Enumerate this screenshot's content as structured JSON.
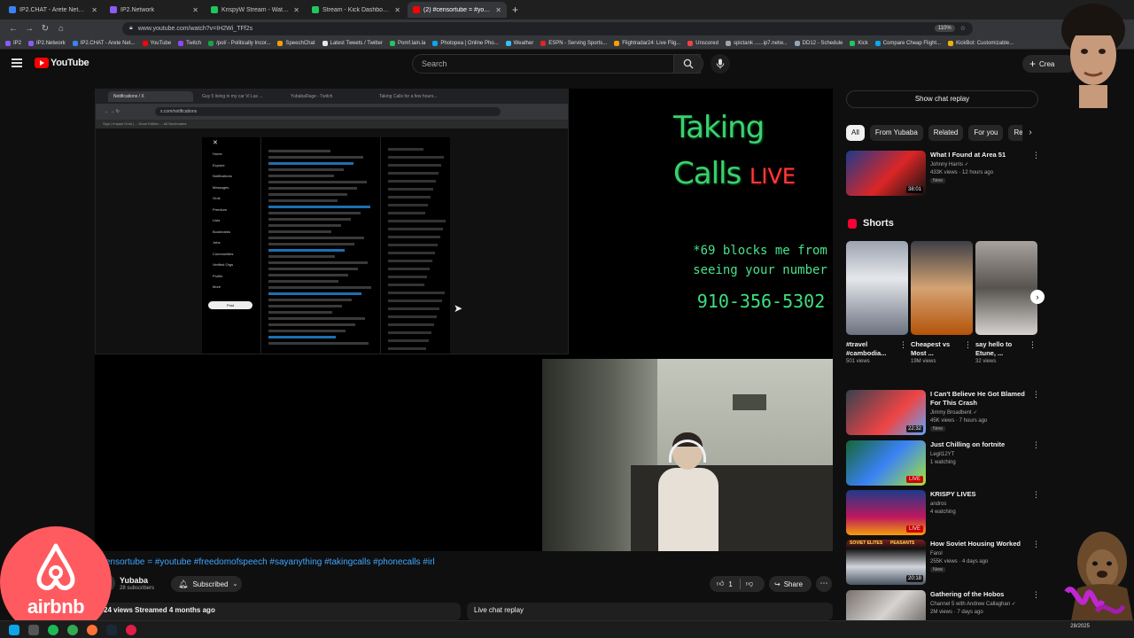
{
  "browser": {
    "tabs": [
      {
        "label": "IP2.CHAT - Arete Network",
        "color": "#3b82f6",
        "active": false
      },
      {
        "label": "IP2.Network",
        "color": "#8b5cf6",
        "active": false
      },
      {
        "label": "KrispyW Stream - Watch Li",
        "color": "#22c55e",
        "active": false
      },
      {
        "label": "Stream - Kick Dashboard",
        "color": "#22c55e",
        "active": false
      },
      {
        "label": "(2) #censortube = #youtube #",
        "color": "#ff0000",
        "active": true
      }
    ],
    "url": "www.youtube.com/watch?v=IH2Wi_TFf2s",
    "zoom": "110%",
    "bookmarks": [
      "IP2",
      "IP2.Network",
      "IP2.CHAT - Arete Net...",
      "YouTube",
      "Twitch",
      "/pol/ - Politically Incor...",
      "SpeechChat",
      "Latest Tweets / Twitter",
      "Pomf.lain.la",
      "Photopea | Online Pho...",
      "Weather",
      "ESPN - Serving Sports...",
      "Flightradar24: Live Flig...",
      "Unscored",
      "spictank ......ip7.netw...",
      "DD12 - Schedule",
      "Kick",
      "Compare Cheap Flight...",
      "KickBot: Customizable..."
    ]
  },
  "youtube": {
    "logo": "YouTube",
    "search_placeholder": "Search",
    "create_label": "Crea"
  },
  "stream_overlay": {
    "title_line1": "Taking",
    "title_line2": "Calls",
    "live_word": "LIVE",
    "block_note": "*69 blocks me from seeing your number",
    "phone": "910-356-5302"
  },
  "screenshare": {
    "tabs": [
      "Notifications / X",
      "Guy 5 living in my car Vi Las ...",
      "YubabaRage - Twitch",
      "Taking Calls for a few hours..."
    ],
    "url": "x.com/notifications",
    "bookmarks_line": "Sign | Impact Gold | ... Done Edition ... All Bookmarks",
    "post_button": "Post",
    "nav": [
      "Home",
      "Explore",
      "Notifications",
      "Messages",
      "Grok",
      "Premium",
      "Lists",
      "Bookmarks",
      "Jobs",
      "Communities",
      "Verified Orgs",
      "Profile",
      "More"
    ]
  },
  "video": {
    "title": "#censortube = #youtube #freedomofspeech #sayanything #takingcalls #phonecalls #irl",
    "title_visible": "ensortube = #youtube #freedomofspeech #sayanything #takingcalls #phonecalls #irl",
    "channel": "Yubaba",
    "subscribers": "28 subscribers",
    "subscribe_label": "Subscribed",
    "likes": "1",
    "share_label": "Share",
    "views_line": "24 views  Streamed 4 months ago",
    "live_chat_replay": "Live chat replay"
  },
  "sidebar": {
    "show_chat_replay": "Show chat replay",
    "chips": [
      "All",
      "From Yubaba",
      "Related",
      "For you",
      "Re"
    ],
    "shorts_heading": "Shorts",
    "recs": [
      {
        "title": "What I Found at Area 51",
        "channel": "Johnny Harris",
        "meta": "433K views · 12 hours ago",
        "badge": "New",
        "duration": "38:01",
        "verified": true
      },
      {
        "title": "I Can't Believe He Got Blamed For This Crash",
        "channel": "Jimmy Broadbent",
        "meta": "45K views · 7 hours ago",
        "badge": "New",
        "duration": "22:32",
        "verified": true
      },
      {
        "title": "Just Chilling on fortnite",
        "channel": "Legit12YT",
        "meta": "1 watching",
        "badge": "",
        "duration": "LIVE",
        "verified": false
      },
      {
        "title": "KRISPY LIVES",
        "channel": "andros",
        "meta": "4 watching",
        "badge": "",
        "duration": "LIVE",
        "verified": false
      },
      {
        "title": "How Soviet Housing Worked",
        "channel": "Farol",
        "meta": "255K views · 4 days ago",
        "badge": "New",
        "duration": "20:18",
        "verified": false
      },
      {
        "title": "Gathering of the Hobos",
        "channel": "Channel 5 with Andrew Callaghan",
        "meta": "2M views · 7 days ago",
        "badge": "",
        "duration": "",
        "verified": true
      }
    ],
    "shorts": [
      {
        "title": "#travel #cambodia...",
        "views": "501 views"
      },
      {
        "title": "Cheapest vs Most ...",
        "views": "19M views"
      },
      {
        "title": "say hello to Etune, ...",
        "views": "32 views"
      }
    ]
  },
  "overlays": {
    "airbnb": "airbnb",
    "soviet_labels": [
      "SOVIET ELITES",
      "PEASANTS"
    ]
  },
  "taskbar": {
    "clock_time": "",
    "clock_date": "28/2025"
  }
}
